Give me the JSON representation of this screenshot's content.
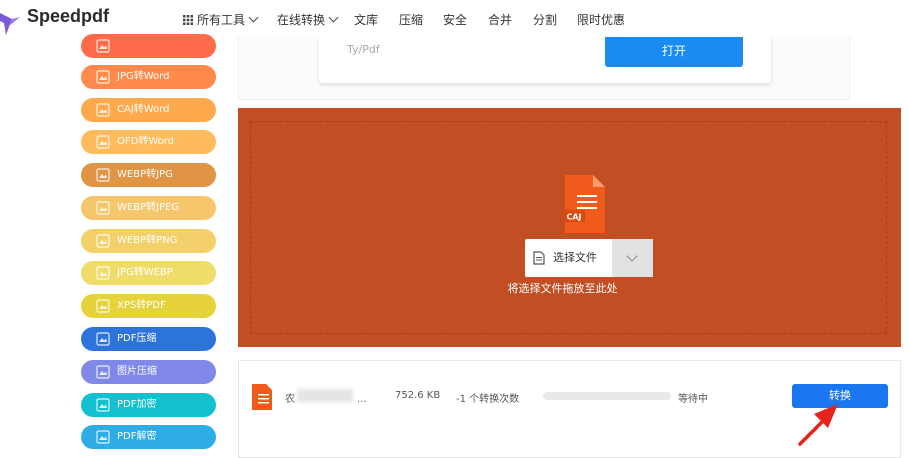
{
  "brand": {
    "name": "Speedpdf"
  },
  "nav": {
    "items": [
      {
        "label": "所有工具",
        "icon": "grid-icon",
        "dropdown": true
      },
      {
        "label": "在线转换",
        "dropdown": true
      },
      {
        "label": "文库"
      },
      {
        "label": "压缩"
      },
      {
        "label": "安全"
      },
      {
        "label": "合并"
      },
      {
        "label": "分割"
      },
      {
        "label": "限时优惠"
      }
    ]
  },
  "sidebar": {
    "items": [
      {
        "label": "",
        "color": "#ff6b4a"
      },
      {
        "label": "JPG转Word",
        "color": "#ff8a4c"
      },
      {
        "label": "CAJ转Word",
        "color": "#ffa94d"
      },
      {
        "label": "OFD转Word",
        "color": "#ffbb5c"
      },
      {
        "label": "WEBP转JPG",
        "color": "#e09446"
      },
      {
        "label": "WEBP转JPEG",
        "color": "#f5c66b"
      },
      {
        "label": "WEBP转PNG",
        "color": "#f3d06a"
      },
      {
        "label": "JPG转WEBP",
        "color": "#f0dc6a"
      },
      {
        "label": "XPS转PDF",
        "color": "#e6d23a"
      },
      {
        "label": "PDF压缩",
        "color": "#2d74da"
      },
      {
        "label": "图片压缩",
        "color": "#8089e8"
      },
      {
        "label": "PDF加密",
        "color": "#12c0cf"
      },
      {
        "label": "PDF解密",
        "color": "#2eace6"
      }
    ]
  },
  "upper": {
    "placeholder": "Ty/Pdf",
    "open_label": "打开"
  },
  "dropzone": {
    "file_type": "CAJ",
    "choose_label": "选择文件",
    "hint": "将选择文件拖放至此处"
  },
  "file_row": {
    "name": "农",
    "name_tail": "...",
    "size": "752.6 KB",
    "count": "-1 个转换次数",
    "progress": 0,
    "status": "等待中",
    "convert_label": "转换"
  },
  "colors": {
    "accent": "#1b77f0",
    "dropzone": "#c24e24",
    "pdf_orange": "#f05a1a"
  }
}
